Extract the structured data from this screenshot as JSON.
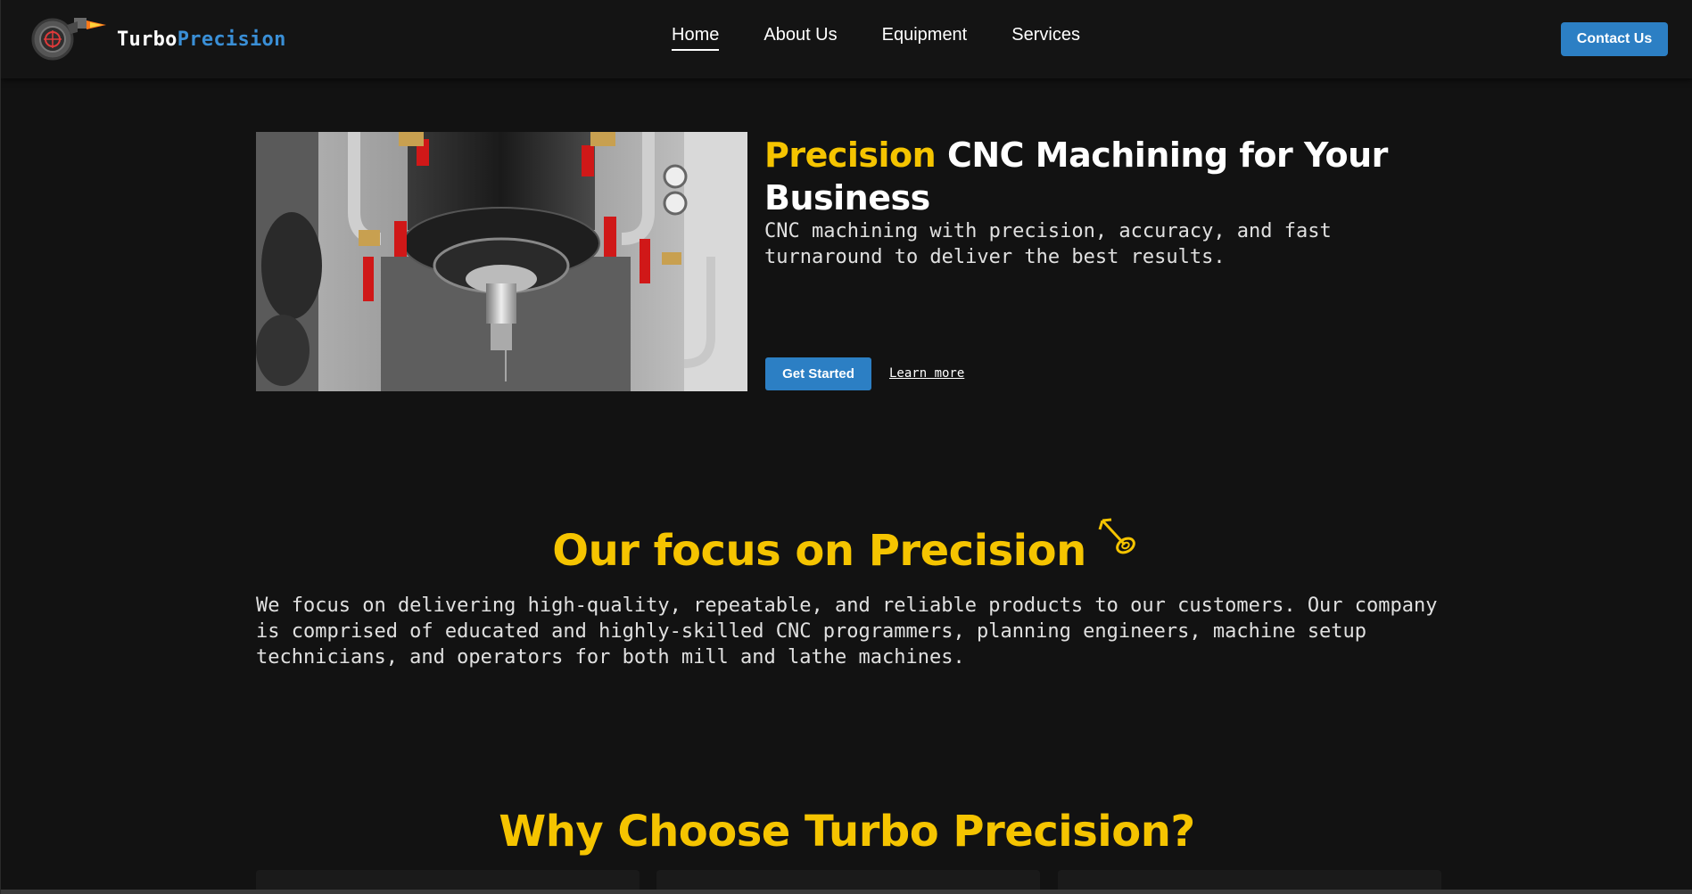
{
  "header": {
    "logo_text_part1": "Turbo",
    "logo_text_part2": "Precision",
    "nav": [
      {
        "label": "Home",
        "active": true
      },
      {
        "label": "About Us",
        "active": false
      },
      {
        "label": "Equipment",
        "active": false
      },
      {
        "label": "Services",
        "active": false
      }
    ],
    "contact_label": "Contact Us"
  },
  "hero": {
    "title_accent": "Precision",
    "title_rest": " CNC Machining for Your Business",
    "description": "CNC machining with precision, accuracy, and fast turnaround to deliver the best results.",
    "primary_button": "Get Started",
    "secondary_link": "Learn more",
    "image_icon": "cnc-spindle-photo"
  },
  "focus": {
    "title": "Our focus on Precision",
    "title_icon": "target-arrow-icon",
    "text": "We focus on delivering high-quality, repeatable, and reliable products to our customers. Our company is comprised of educated and highly-skilled CNC programmers, planning engineers, machine setup technicians, and operators for both mill and lathe machines."
  },
  "why": {
    "title": "Why Choose Turbo Precision?"
  },
  "colors": {
    "background": "#121212",
    "header": "#141414",
    "accent_yellow": "#f5c400",
    "brand_blue": "#2c7fc4",
    "logo_blue": "#3a8fd6"
  }
}
